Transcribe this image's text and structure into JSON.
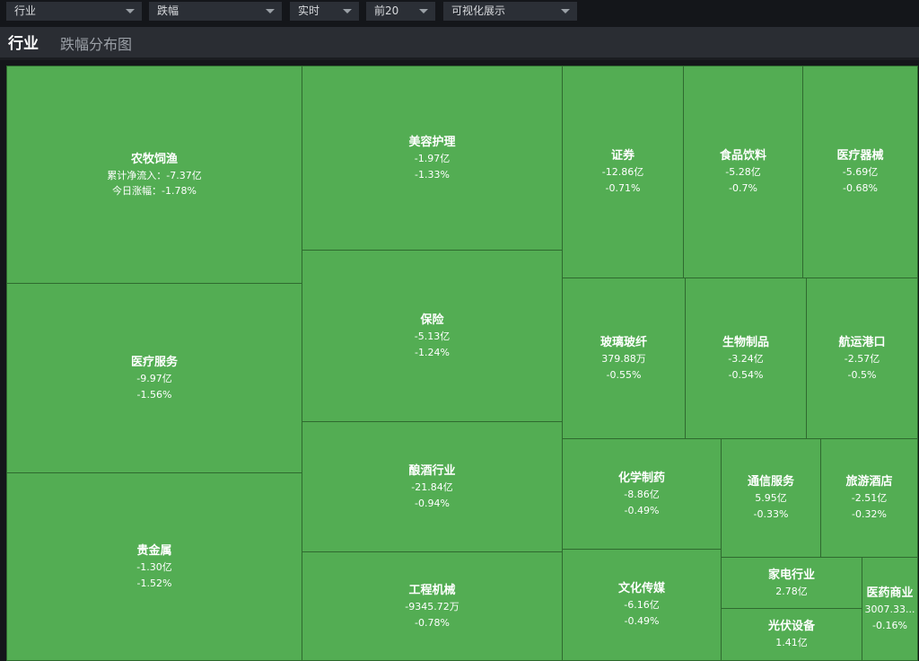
{
  "toolbar": {
    "dropdowns": [
      {
        "label": "行业"
      },
      {
        "label": "跌幅"
      },
      {
        "label": "实时"
      },
      {
        "label": "前20"
      },
      {
        "label": "可视化展示"
      }
    ]
  },
  "header": {
    "title": "行业",
    "subtitle": "跌幅分布图"
  },
  "tiles": [
    {
      "name": "农牧饲渔",
      "v1": "累计净流入：-7.37亿",
      "v2": "今日涨幅：-1.78%"
    },
    {
      "name": "医疗服务",
      "v1": "-9.97亿",
      "v2": "-1.56%"
    },
    {
      "name": "贵金属",
      "v1": "-1.30亿",
      "v2": "-1.52%"
    },
    {
      "name": "美容护理",
      "v1": "-1.97亿",
      "v2": "-1.33%"
    },
    {
      "name": "保险",
      "v1": "-5.13亿",
      "v2": "-1.24%"
    },
    {
      "name": "酿酒行业",
      "v1": "-21.84亿",
      "v2": "-0.94%"
    },
    {
      "name": "工程机械",
      "v1": "-9345.72万",
      "v2": "-0.78%"
    },
    {
      "name": "证券",
      "v1": "-12.86亿",
      "v2": "-0.71%"
    },
    {
      "name": "食品饮料",
      "v1": "-5.28亿",
      "v2": "-0.7%"
    },
    {
      "name": "医疗器械",
      "v1": "-5.69亿",
      "v2": "-0.68%"
    },
    {
      "name": "玻璃玻纤",
      "v1": "379.88万",
      "v2": "-0.55%"
    },
    {
      "name": "生物制品",
      "v1": "-3.24亿",
      "v2": "-0.54%"
    },
    {
      "name": "航运港口",
      "v1": "-2.57亿",
      "v2": "-0.5%"
    },
    {
      "name": "化学制药",
      "v1": "-8.86亿",
      "v2": "-0.49%"
    },
    {
      "name": "通信服务",
      "v1": "5.95亿",
      "v2": "-0.33%"
    },
    {
      "name": "旅游酒店",
      "v1": "-2.51亿",
      "v2": "-0.32%"
    },
    {
      "name": "文化传媒",
      "v1": "-6.16亿",
      "v2": "-0.49%"
    },
    {
      "name": "家电行业",
      "v1": "2.78亿",
      "v2": ""
    },
    {
      "name": "光伏设备",
      "v1": "1.41亿",
      "v2": ""
    },
    {
      "name": "医药商业",
      "v1": "3007.33...",
      "v2": "-0.16%"
    }
  ],
  "colors": {
    "tile": "#53ad53",
    "tile_border": "#2f6a2f",
    "background": "#14161a",
    "header": "#2a2d33"
  }
}
